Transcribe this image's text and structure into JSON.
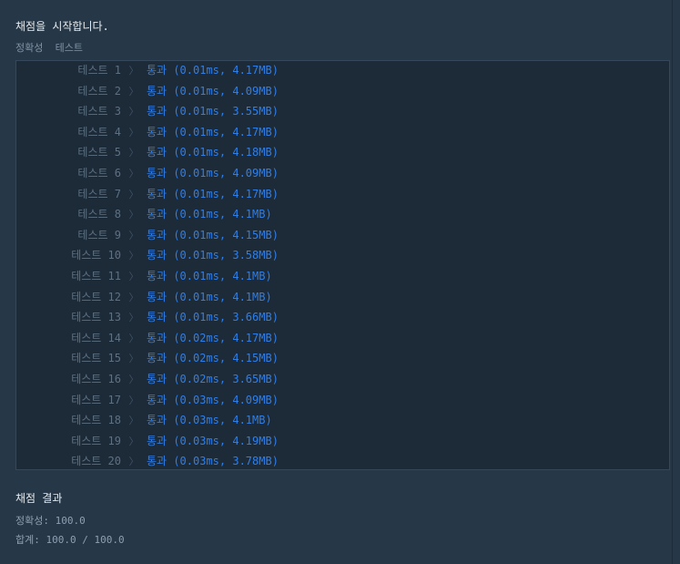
{
  "status": "채점을 시작합니다.",
  "section_label": "정확성  테스트",
  "tests": [
    {
      "label": "테스트 1",
      "verdict": "통과",
      "stats": "(0.01ms, 4.17MB)"
    },
    {
      "label": "테스트 2",
      "verdict": "통과",
      "stats": "(0.01ms, 4.09MB)"
    },
    {
      "label": "테스트 3",
      "verdict": "통과",
      "stats": "(0.01ms, 3.55MB)"
    },
    {
      "label": "테스트 4",
      "verdict": "통과",
      "stats": "(0.01ms, 4.17MB)"
    },
    {
      "label": "테스트 5",
      "verdict": "통과",
      "stats": "(0.01ms, 4.18MB)"
    },
    {
      "label": "테스트 6",
      "verdict": "통과",
      "stats": "(0.01ms, 4.09MB)"
    },
    {
      "label": "테스트 7",
      "verdict": "통과",
      "stats": "(0.01ms, 4.17MB)"
    },
    {
      "label": "테스트 8",
      "verdict": "통과",
      "stats": "(0.01ms, 4.1MB)"
    },
    {
      "label": "테스트 9",
      "verdict": "통과",
      "stats": "(0.01ms, 4.15MB)"
    },
    {
      "label": "테스트 10",
      "verdict": "통과",
      "stats": "(0.01ms, 3.58MB)"
    },
    {
      "label": "테스트 11",
      "verdict": "통과",
      "stats": "(0.01ms, 4.1MB)"
    },
    {
      "label": "테스트 12",
      "verdict": "통과",
      "stats": "(0.01ms, 4.1MB)"
    },
    {
      "label": "테스트 13",
      "verdict": "통과",
      "stats": "(0.01ms, 3.66MB)"
    },
    {
      "label": "테스트 14",
      "verdict": "통과",
      "stats": "(0.02ms, 4.17MB)"
    },
    {
      "label": "테스트 15",
      "verdict": "통과",
      "stats": "(0.02ms, 4.15MB)"
    },
    {
      "label": "테스트 16",
      "verdict": "통과",
      "stats": "(0.02ms, 3.65MB)"
    },
    {
      "label": "테스트 17",
      "verdict": "통과",
      "stats": "(0.03ms, 4.09MB)"
    },
    {
      "label": "테스트 18",
      "verdict": "통과",
      "stats": "(0.03ms, 4.1MB)"
    },
    {
      "label": "테스트 19",
      "verdict": "통과",
      "stats": "(0.03ms, 4.19MB)"
    },
    {
      "label": "테스트 20",
      "verdict": "통과",
      "stats": "(0.03ms, 3.78MB)"
    }
  ],
  "chevron_icon": "chevron-right-icon",
  "summary": {
    "title": "채점 결과",
    "accuracy": "정확성: 100.0",
    "total": "합계: 100.0 / 100.0"
  },
  "colors": {
    "background": "#263747",
    "panel": "#1d2a38",
    "pass": "#2f7fe9",
    "muted": "#5d7183"
  }
}
